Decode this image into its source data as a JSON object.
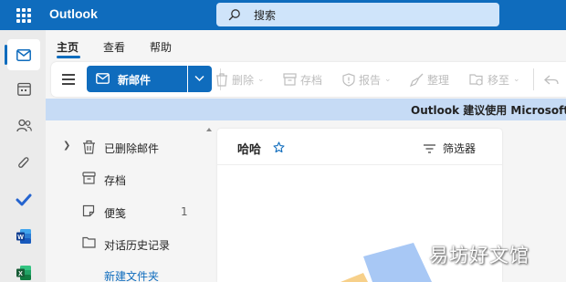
{
  "header": {
    "app_name": "Outlook",
    "search_placeholder": "搜索",
    "brand_color": "#0f6cbd"
  },
  "rail": {
    "apps": [
      "mail-icon",
      "calendar-icon",
      "people-icon",
      "attach-icon",
      "todo-icon",
      "word-icon",
      "excel-icon"
    ]
  },
  "ribbon": {
    "tabs": [
      {
        "label": "主页",
        "active": true
      },
      {
        "label": "查看",
        "active": false
      },
      {
        "label": "帮助",
        "active": false
      }
    ]
  },
  "toolbar": {
    "new_mail_label": "新邮件",
    "delete_label": "删除",
    "archive_label": "存档",
    "report_label": "报告",
    "sweep_label": "整理",
    "move_label": "移至"
  },
  "banner": {
    "text": "Outlook 建议使用 Microsoft"
  },
  "folders": {
    "items": [
      {
        "label": "已删除邮件",
        "icon": "trash-icon",
        "count": "",
        "expandable": true
      },
      {
        "label": "存档",
        "icon": "archive-icon",
        "count": "",
        "expandable": false
      },
      {
        "label": "便笺",
        "icon": "note-icon",
        "count": "1",
        "expandable": false
      },
      {
        "label": "对话历史记录",
        "icon": "folder-icon",
        "count": "",
        "expandable": false
      }
    ],
    "new_folder_label": "新建文件夹"
  },
  "message_list": {
    "title": "哈哈",
    "filter_label": "筛选器"
  },
  "watermark": "易坊好文馆"
}
